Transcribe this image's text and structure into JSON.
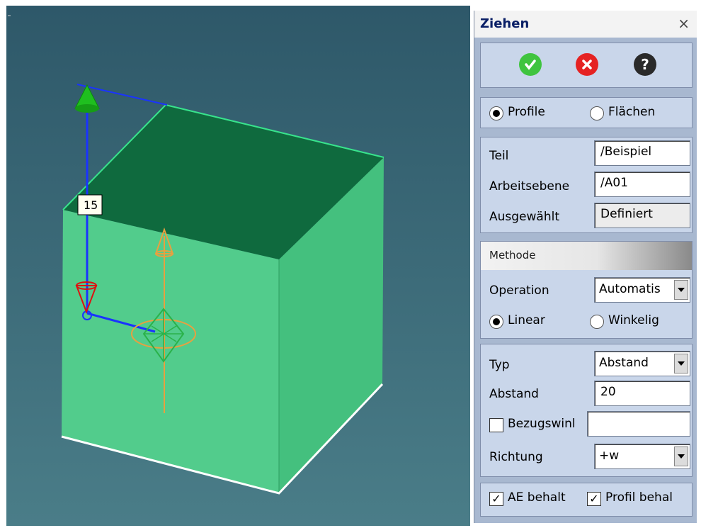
{
  "viewport": {
    "dimension_label": "15"
  },
  "panel": {
    "title": "Ziehen",
    "close": "×",
    "actions": {
      "ok_icon": "check-icon",
      "cancel_icon": "cancel-icon",
      "help_icon": "help-icon",
      "help_glyph": "?"
    },
    "mode": {
      "profile_label": "Profile",
      "faces_label": "Flächen",
      "selected": "Profile"
    },
    "part": {
      "teil_label": "Teil",
      "teil_value": "/Beispiel",
      "ebene_label": "Arbeitsebene",
      "ebene_value": "/A01",
      "ausgewaehlt_label": "Ausgewählt",
      "ausgewaehlt_value": "Definiert"
    },
    "methode": {
      "header": "Methode",
      "operation_label": "Operation",
      "operation_value": "Automatis",
      "linear_label": "Linear",
      "winkelig_label": "Winkelig",
      "selected": "Linear"
    },
    "params": {
      "typ_label": "Typ",
      "typ_value": "Abstand",
      "abstand_label": "Abstand",
      "abstand_value": "20",
      "bezug_label": "Bezugswinl",
      "bezug_value": "",
      "richtung_label": "Richtung",
      "richtung_value": "+w"
    },
    "options": {
      "ae_label": "AE behalt",
      "profil_label": "Profil behal",
      "ae_checked": true,
      "profil_checked": true
    },
    "colors": {
      "panel_bg": "#a8b8d0",
      "group_bg": "#c9d6ea",
      "box_face": "#4fcf8a",
      "box_top": "#0c6b3c",
      "title": "#0a1f66"
    }
  }
}
